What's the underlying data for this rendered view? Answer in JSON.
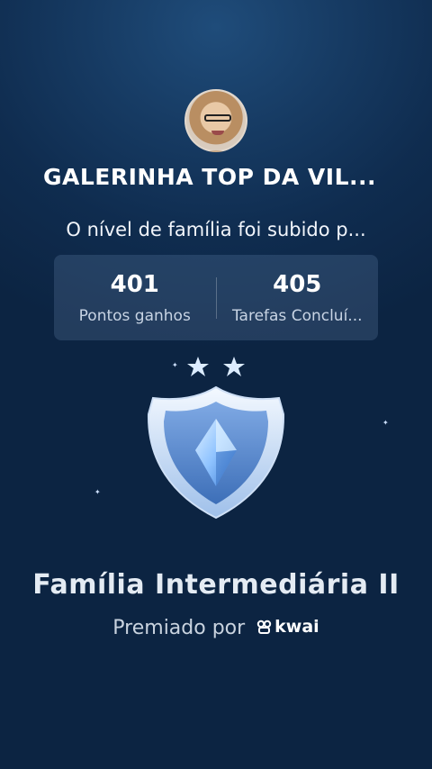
{
  "header": {
    "family_name": "GALERINHA  TOP DA VIL...",
    "message": "O nível de família foi subido p..."
  },
  "stats": [
    {
      "value": "401",
      "label": "Pontos ganhos"
    },
    {
      "value": "405",
      "label": "Tarefas Concluí..."
    }
  ],
  "badge": {
    "stars": 2,
    "icon": "shield-crystal-icon",
    "colors": {
      "shield_light": "#e6f1ff",
      "shield_blue": "#5c8fd6",
      "crystal": "#8fc3ff"
    }
  },
  "award": {
    "title": "Família Intermediária II",
    "awarded_by": "Premiado por",
    "brand": "kwai"
  },
  "colors": {
    "background": "#12365c",
    "text": "#ffffff",
    "stats_panel": "#3a5373"
  }
}
